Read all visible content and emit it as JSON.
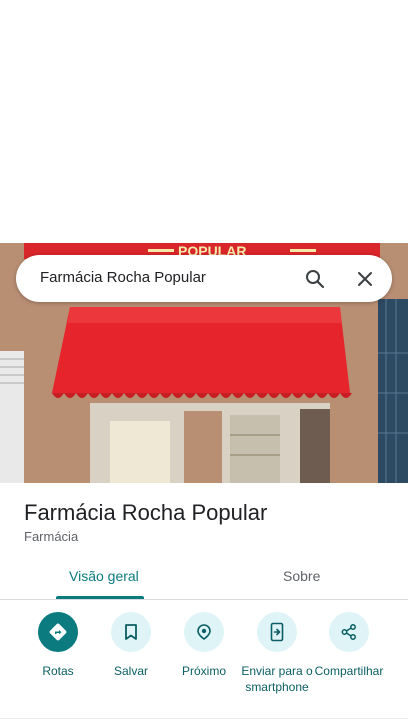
{
  "search": {
    "query": "Farmácia Rocha Popular"
  },
  "photo": {
    "sign_text": "POPULAR"
  },
  "place": {
    "name": "Farmácia Rocha Popular",
    "category": "Farmácia"
  },
  "tabs": [
    {
      "label": "Visão geral",
      "active": true
    },
    {
      "label": "Sobre",
      "active": false
    }
  ],
  "actions": [
    {
      "label": "Rotas",
      "icon": "directions-icon"
    },
    {
      "label": "Salvar",
      "icon": "bookmark-icon"
    },
    {
      "label": "Próximo",
      "icon": "nearby-icon"
    },
    {
      "label": "Enviar para o smartphone",
      "icon": "send-to-phone-icon"
    },
    {
      "label": "Compartilhar",
      "icon": "share-icon"
    }
  ],
  "colors": {
    "accent": "#0b7b7f",
    "action_bg": "#dff4f7",
    "awning_red": "#e5252b"
  }
}
